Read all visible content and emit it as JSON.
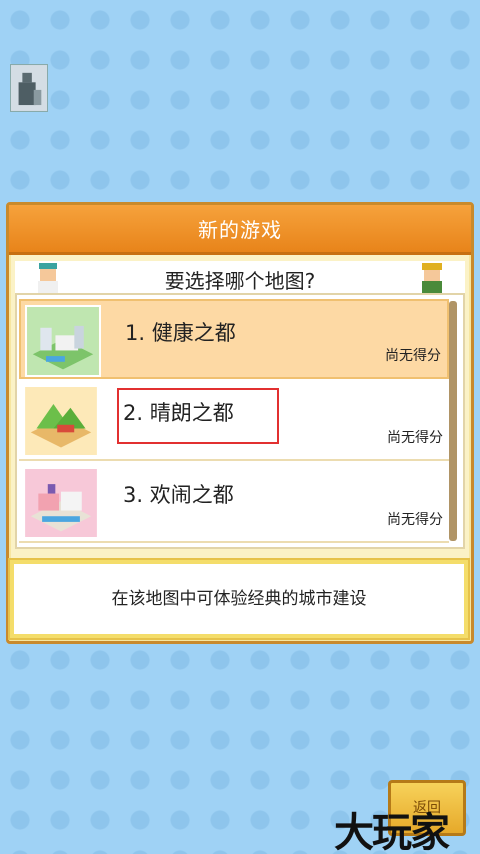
{
  "dialog": {
    "title": "新的游戏",
    "question": "要选择哪个地图?"
  },
  "maps": [
    {
      "name": "1. 健康之都",
      "score": "尚无得分",
      "selected": true
    },
    {
      "name": "2. 晴朗之都",
      "score": "尚无得分",
      "selected": false
    },
    {
      "name": "3. 欢闹之都",
      "score": "尚无得分",
      "selected": false
    }
  ],
  "description": "在该地图中可体验经典的城市建设",
  "back_button": "返回",
  "watermark": "大玩家",
  "colors": {
    "background": "#9fd2f5",
    "header_orange": "#f29a30",
    "selected_row": "#fdd9a4",
    "highlight_red": "#e23030"
  },
  "icons": {
    "avatar": "statue-avatar-icon",
    "map1": "city-thumbnail-icon",
    "map2": "hill-thumbnail-icon",
    "map3": "park-thumbnail-icon"
  }
}
